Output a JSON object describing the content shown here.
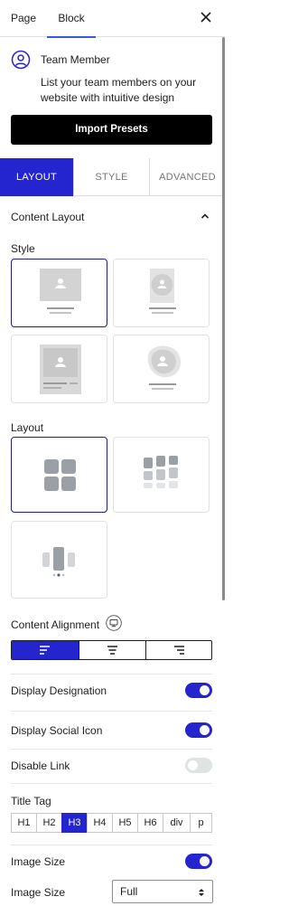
{
  "header": {
    "tab_page": "Page",
    "tab_block": "Block"
  },
  "block_card": {
    "title": "Team Member",
    "description": "List your team members on your website with intuitive design"
  },
  "import_presets": "Import Presets",
  "tabs": [
    "LAYOUT",
    "STYLE",
    "ADVANCED"
  ],
  "content_layout": {
    "heading": "Content Layout",
    "style_label": "Style",
    "layout_label": "Layout",
    "alignment_label": "Content Alignment"
  },
  "toggles": {
    "display_designation": {
      "label": "Display Designation",
      "on": true
    },
    "display_social_icon": {
      "label": "Display Social Icon",
      "on": true
    },
    "disable_link": {
      "label": "Disable Link",
      "on": false
    },
    "image_size_toggle": {
      "label": "Image Size",
      "on": true
    }
  },
  "title_tag": {
    "label": "Title Tag",
    "options": [
      "H1",
      "H2",
      "H3",
      "H4",
      "H5",
      "H6",
      "div",
      "p"
    ],
    "selected": "H3"
  },
  "image_size": {
    "label": "Image Size",
    "value": "Full"
  },
  "colors": {
    "accent": "#2525d0",
    "border_selected": "#1e1e8e"
  }
}
